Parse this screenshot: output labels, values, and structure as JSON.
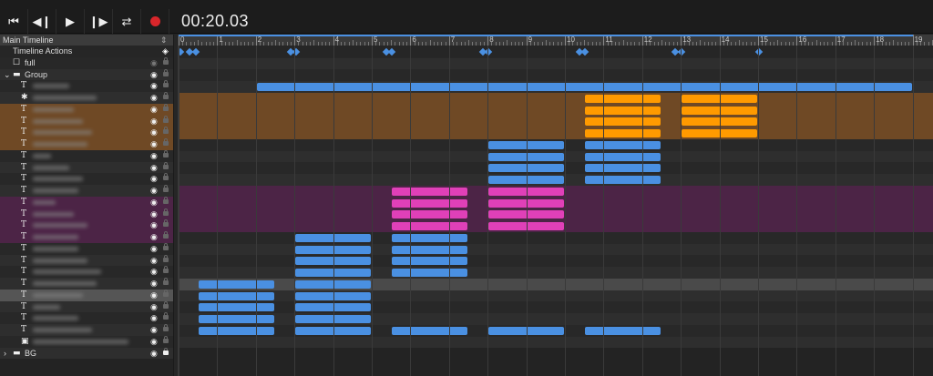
{
  "toolbar": {
    "buttons": [
      "skip-to-start",
      "step-back",
      "play",
      "step-forward",
      "loop",
      "record"
    ],
    "time": "00:20.03",
    "record_color": "#d9262b"
  },
  "header": {
    "title": "Main Timeline"
  },
  "timeline": {
    "ruler_labels": [
      "0",
      "1",
      "2",
      "3",
      "4",
      "5",
      "6",
      "7",
      "8",
      "9",
      "10",
      "11",
      "12",
      "13",
      "14",
      "15",
      "16",
      "17",
      "18",
      "19"
    ],
    "duration_seconds": 19,
    "actions_label": "Timeline Actions",
    "keyframes": [
      0,
      0.24,
      0.4,
      2.85,
      3.0,
      5.33,
      5.47,
      7.83,
      7.97,
      10.33,
      10.47,
      12.8,
      12.97,
      14.98
    ]
  },
  "colors": {
    "blue": "#4a90e2",
    "orange": "#ff9a00",
    "pink": "#e040b8",
    "orange_band": "#6f4925",
    "purple_band": "#4c2446",
    "highlight": "#555555"
  },
  "rows": [
    {
      "icon": "checkbox",
      "label": "full",
      "indent": 1,
      "eye_dim": true
    },
    {
      "icon": "folder",
      "label": "Group",
      "indent": 0,
      "expanded": true
    },
    {
      "icon": "text",
      "blur": 40,
      "bars": []
    },
    {
      "icon": "puzzle",
      "blur": 70,
      "bars": [
        [
          2,
          19,
          "blue"
        ]
      ]
    },
    {
      "icon": "text",
      "blur": 45,
      "band": "orange_band",
      "bars": [
        [
          10.5,
          12.5,
          "orange"
        ],
        [
          13,
          15,
          "orange"
        ]
      ]
    },
    {
      "icon": "text",
      "blur": 55,
      "band": "orange_band",
      "bars": [
        [
          10.5,
          12.5,
          "orange"
        ],
        [
          13,
          15,
          "orange"
        ]
      ]
    },
    {
      "icon": "text",
      "blur": 65,
      "band": "orange_band",
      "bars": [
        [
          10.5,
          12.5,
          "orange"
        ],
        [
          13,
          15,
          "orange"
        ]
      ]
    },
    {
      "icon": "text",
      "blur": 60,
      "band": "orange_band",
      "bars": [
        [
          10.5,
          12.5,
          "orange"
        ],
        [
          13,
          15,
          "orange"
        ]
      ]
    },
    {
      "icon": "text",
      "blur": 20,
      "bars": [
        [
          8,
          10,
          "blue"
        ],
        [
          10.5,
          12.5,
          "blue"
        ]
      ]
    },
    {
      "icon": "text",
      "blur": 40,
      "bars": [
        [
          8,
          10,
          "blue"
        ],
        [
          10.5,
          12.5,
          "blue"
        ]
      ]
    },
    {
      "icon": "text",
      "blur": 55,
      "bars": [
        [
          8,
          10,
          "blue"
        ],
        [
          10.5,
          12.5,
          "blue"
        ]
      ]
    },
    {
      "icon": "text",
      "blur": 50,
      "bars": [
        [
          8,
          10,
          "blue"
        ],
        [
          10.5,
          12.5,
          "blue"
        ]
      ]
    },
    {
      "icon": "text",
      "blur": 25,
      "band": "purple_band",
      "bars": [
        [
          5.5,
          7.5,
          "pink"
        ],
        [
          8,
          10,
          "pink"
        ]
      ]
    },
    {
      "icon": "text",
      "blur": 45,
      "band": "purple_band",
      "bars": [
        [
          5.5,
          7.5,
          "pink"
        ],
        [
          8,
          10,
          "pink"
        ]
      ]
    },
    {
      "icon": "text",
      "blur": 60,
      "band": "purple_band",
      "bars": [
        [
          5.5,
          7.5,
          "pink"
        ],
        [
          8,
          10,
          "pink"
        ]
      ]
    },
    {
      "icon": "text",
      "blur": 50,
      "band": "purple_band",
      "bars": [
        [
          5.5,
          7.5,
          "pink"
        ],
        [
          8,
          10,
          "pink"
        ]
      ]
    },
    {
      "icon": "text",
      "blur": 50,
      "bars": [
        [
          3,
          5,
          "blue"
        ],
        [
          5.5,
          7.5,
          "blue"
        ]
      ]
    },
    {
      "icon": "text",
      "blur": 60,
      "bars": [
        [
          3,
          5,
          "blue"
        ],
        [
          5.5,
          7.5,
          "blue"
        ]
      ]
    },
    {
      "icon": "text",
      "blur": 75,
      "bars": [
        [
          3,
          5,
          "blue"
        ],
        [
          5.5,
          7.5,
          "blue"
        ]
      ]
    },
    {
      "icon": "text",
      "blur": 70,
      "bars": [
        [
          3,
          5,
          "blue"
        ],
        [
          5.5,
          7.5,
          "blue"
        ]
      ]
    },
    {
      "icon": "text",
      "blur": 55,
      "highlight": true,
      "bars": [
        [
          0.5,
          2.5,
          "blue"
        ],
        [
          3,
          5,
          "blue"
        ]
      ]
    },
    {
      "icon": "text",
      "blur": 30,
      "bars": [
        [
          0.5,
          2.5,
          "blue"
        ],
        [
          3,
          5,
          "blue"
        ]
      ]
    },
    {
      "icon": "text",
      "blur": 50,
      "bars": [
        [
          0.5,
          2.5,
          "blue"
        ],
        [
          3,
          5,
          "blue"
        ]
      ]
    },
    {
      "icon": "text",
      "blur": 65,
      "bars": [
        [
          0.5,
          2.5,
          "blue"
        ],
        [
          3,
          5,
          "blue"
        ]
      ]
    },
    {
      "icon": "image",
      "blur": 105,
      "bars": [
        [
          0.5,
          2.5,
          "blue"
        ],
        [
          3,
          5,
          "blue"
        ],
        [
          5.5,
          7.5,
          "blue"
        ],
        [
          8,
          10,
          "blue"
        ],
        [
          10.5,
          12.5,
          "blue"
        ]
      ]
    },
    {
      "icon": "folder",
      "label": "BG",
      "indent": 0,
      "expanded": false,
      "locked": true
    }
  ]
}
